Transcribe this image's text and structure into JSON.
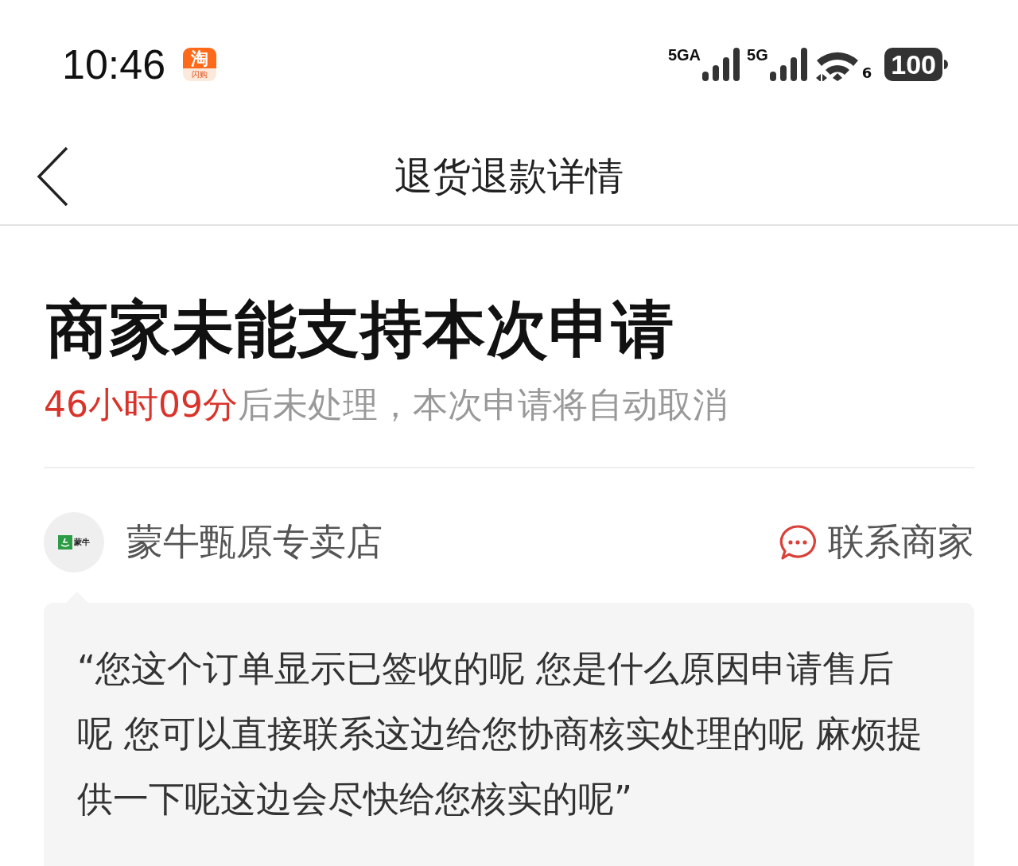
{
  "status_bar": {
    "time": "10:46",
    "app_icon": {
      "main": "淘",
      "sub": "闪购"
    },
    "network_1": "5GA",
    "network_2": "5G",
    "wifi_version": "6",
    "battery": "100"
  },
  "nav_bar": {
    "title": "退货退款详情"
  },
  "status": {
    "title": "商家未能支持本次申请",
    "countdown": "46小时09分",
    "message": "后未处理，本次申请将自动取消"
  },
  "store": {
    "logo_text": "蒙牛",
    "name": "蒙牛甄原专卖店",
    "contact": "联系商家"
  },
  "merchant_message": "“您这个订单显示已签收的呢 您是什么原因申请售后呢 您可以直接联系这边给您协商核实处理的呢 麻烦提供一下呢这边会尽快给您核实的呢”"
}
